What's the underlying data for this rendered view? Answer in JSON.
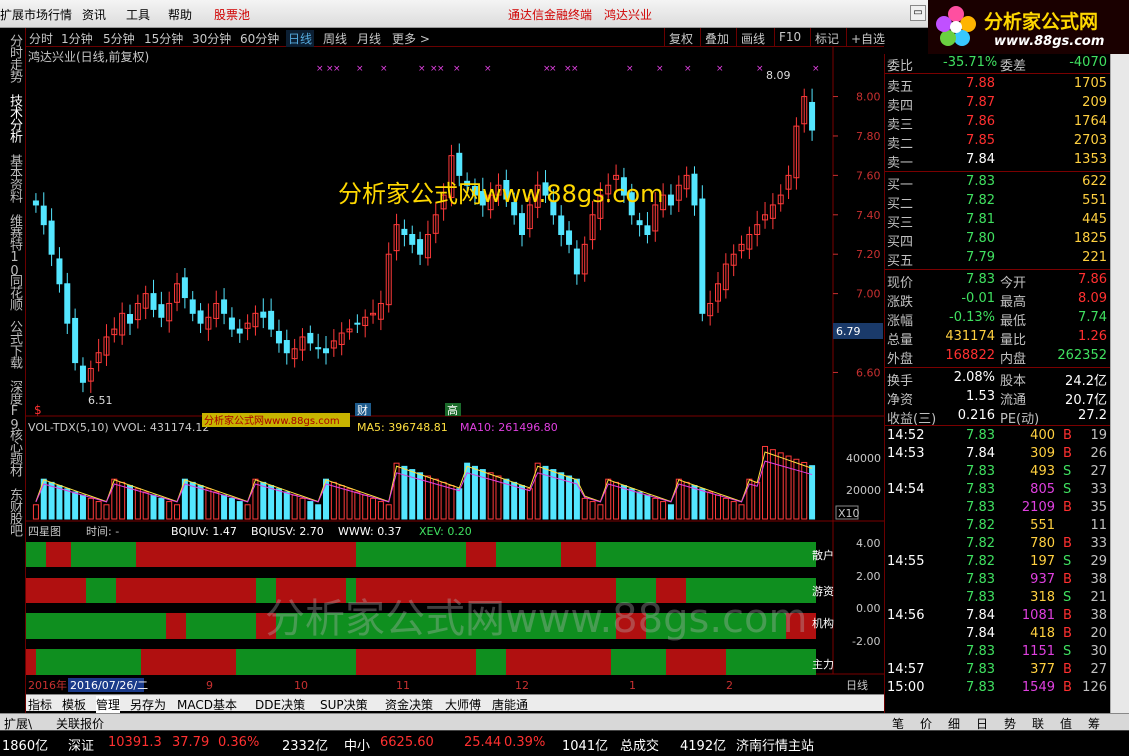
{
  "menu": {
    "items": [
      "扩展市场行情",
      "资讯",
      "工具",
      "帮助",
      "股票池",
      "通达信金融终端",
      "鸿达兴业"
    ]
  },
  "logo": {
    "title": "分析家公式网",
    "url": "www.88gs.com"
  },
  "left_tabs": [
    "分时走势",
    "技术分析",
    "基本资料",
    "维赛特10",
    "同花顺",
    "公式下载",
    "深度F9",
    "核心题材",
    "东财股吧"
  ],
  "period_tabs": [
    "分时",
    "1分钟",
    "5分钟",
    "15分钟",
    "30分钟",
    "60分钟",
    "日线",
    "周线",
    "月线",
    "更多 >"
  ],
  "toolbar_right": [
    "复权",
    "叠加",
    "画线",
    "F10",
    "标记",
    "+自选"
  ],
  "chart_title": "鸿达兴业(日线,前复权)",
  "watermark": "分析家公式网www.88gs.com",
  "watermark2": "分析家公式网www.88gs.com",
  "price_chart": {
    "ylim": [
      6.45,
      8.15
    ],
    "y_ticks": [
      "8.00",
      "7.80",
      "7.60",
      "7.40",
      "7.20",
      "7.00",
      "6.80",
      "6.60"
    ],
    "high_label": "8.09",
    "low_label": "6.51",
    "current_price_tag": "6.79",
    "markers": {
      "dollar": "$",
      "cai": "财",
      "gao": "高"
    }
  },
  "vol_panel": {
    "label": "VOL-TDX(5,10)",
    "vvol": "VVOL: 431174.12",
    "ma5": "MA5: 396748.81",
    "ma10": "MA10: 261496.80",
    "overlay": "分析家公式网www.88gs.com",
    "y_ticks": [
      "40000",
      "20000"
    ],
    "scale": "X10"
  },
  "sub_panel": {
    "label": "四星图",
    "time": "时间: -",
    "bqiuv": "BQIUV: 1.47",
    "bqiusv": "BQIUSV: 2.70",
    "www": "WWW: 0.37",
    "xev": "XEV: 0.20",
    "band_labels": [
      "散户",
      "游资",
      "机构",
      "主力"
    ],
    "y_ticks": [
      "4.00",
      "2.00",
      "0.00",
      "-2.00"
    ]
  },
  "date_axis": {
    "year": "2016年",
    "cursor_date": "2016/07/26/二",
    "months": [
      "9",
      "10",
      "11",
      "12",
      "1",
      "2"
    ],
    "period": "日线"
  },
  "bottom_tabs": [
    "指标",
    "模板",
    "管理",
    "另存为",
    "MACD基本",
    "DDE决策",
    "SUP决策",
    "资金决策",
    "大师傅",
    "唐能通"
  ],
  "bottom_tabs2": [
    "扩展\\",
    "关联报价"
  ],
  "quote": {
    "weibi_label": "委比",
    "weibi": "-35.71%",
    "weicha_label": "委差",
    "weicha": "-4070",
    "asks": [
      {
        "label": "卖五",
        "price": "7.88",
        "vol": "1705"
      },
      {
        "label": "卖四",
        "price": "7.87",
        "vol": "209"
      },
      {
        "label": "卖三",
        "price": "7.86",
        "vol": "1764"
      },
      {
        "label": "卖二",
        "price": "7.85",
        "vol": "2703"
      },
      {
        "label": "卖一",
        "price": "7.84",
        "vol": "1353"
      }
    ],
    "bids": [
      {
        "label": "买一",
        "price": "7.83",
        "vol": "622"
      },
      {
        "label": "买二",
        "price": "7.82",
        "vol": "551"
      },
      {
        "label": "买三",
        "price": "7.81",
        "vol": "445"
      },
      {
        "label": "买四",
        "price": "7.80",
        "vol": "1825"
      },
      {
        "label": "买五",
        "price": "7.79",
        "vol": "221"
      }
    ],
    "stats": [
      {
        "l1": "现价",
        "v1": "7.83",
        "l2": "今开",
        "v2": "7.86"
      },
      {
        "l1": "涨跌",
        "v1": "-0.01",
        "l2": "最高",
        "v2": "8.09"
      },
      {
        "l1": "涨幅",
        "v1": "-0.13%",
        "l2": "最低",
        "v2": "7.74"
      },
      {
        "l1": "总量",
        "v1": "431174",
        "l2": "量比",
        "v2": "1.26"
      },
      {
        "l1": "外盘",
        "v1": "168822",
        "l2": "内盘",
        "v2": "262352"
      }
    ],
    "stats2": [
      {
        "l1": "换手",
        "v1": "2.08%",
        "l2": "股本",
        "v2": "24.2亿"
      },
      {
        "l1": "净资",
        "v1": "1.53",
        "l2": "流通",
        "v2": "20.7亿"
      },
      {
        "l1": "收益(三)",
        "v1": "0.216",
        "l2": "PE(动)",
        "v2": "27.2"
      }
    ],
    "ticks": [
      {
        "t": "14:52",
        "p": "7.83",
        "v": "400",
        "bs": "B",
        "n": "19"
      },
      {
        "t": "14:53",
        "p": "7.84",
        "v": "309",
        "bs": "B",
        "n": "26"
      },
      {
        "t": "",
        "p": "7.83",
        "v": "493",
        "bs": "S",
        "n": "27"
      },
      {
        "t": "14:54",
        "p": "7.83",
        "v": "805",
        "bs": "S",
        "n": "33"
      },
      {
        "t": "",
        "p": "7.83",
        "v": "2109",
        "bs": "B",
        "n": "35"
      },
      {
        "t": "",
        "p": "7.82",
        "v": "551",
        "bs": "",
        "n": "11"
      },
      {
        "t": "",
        "p": "7.82",
        "v": "780",
        "bs": "B",
        "n": "33"
      },
      {
        "t": "14:55",
        "p": "7.82",
        "v": "197",
        "bs": "S",
        "n": "29"
      },
      {
        "t": "",
        "p": "7.83",
        "v": "937",
        "bs": "B",
        "n": "38"
      },
      {
        "t": "",
        "p": "7.83",
        "v": "318",
        "bs": "S",
        "n": "21"
      },
      {
        "t": "14:56",
        "p": "7.84",
        "v": "1081",
        "bs": "B",
        "n": "38"
      },
      {
        "t": "",
        "p": "7.84",
        "v": "418",
        "bs": "B",
        "n": "20"
      },
      {
        "t": "",
        "p": "7.83",
        "v": "1151",
        "bs": "S",
        "n": "30"
      },
      {
        "t": "14:57",
        "p": "7.83",
        "v": "377",
        "bs": "B",
        "n": "27"
      },
      {
        "t": "15:00",
        "p": "7.83",
        "v": "1549",
        "bs": "B",
        "n": "126"
      }
    ]
  },
  "rp_tabs": [
    "笔",
    "价",
    "细",
    "日",
    "势",
    "联",
    "值",
    "筹"
  ],
  "statusbar": {
    "items": [
      "1860亿",
      "深证",
      "10391.3",
      "37.79",
      "0.36%",
      "2332亿",
      "中小",
      "6625.60",
      "25.44",
      "0.39%",
      "1041亿",
      "总成交",
      "4192亿",
      "济南行情主站"
    ]
  },
  "chart_data": {
    "type": "candlestick",
    "title": "鸿达兴业(日线,前复权)",
    "x_months": [
      "9",
      "10",
      "11",
      "12",
      "1",
      "2"
    ],
    "ylim": [
      6.45,
      8.15
    ],
    "approx_close": [
      7.45,
      7.35,
      7.2,
      7.05,
      6.85,
      6.65,
      6.55,
      6.62,
      6.7,
      6.78,
      6.82,
      6.9,
      6.85,
      6.95,
      7.0,
      6.92,
      6.88,
      6.95,
      7.05,
      6.98,
      6.9,
      6.85,
      6.88,
      6.95,
      6.9,
      6.82,
      6.8,
      6.85,
      6.9,
      6.88,
      6.82,
      6.75,
      6.7,
      6.72,
      6.78,
      6.75,
      6.72,
      6.7,
      6.76,
      6.8,
      6.82,
      6.85,
      6.88,
      6.9,
      6.95,
      7.2,
      7.35,
      7.3,
      7.25,
      7.2,
      7.3,
      7.4,
      7.5,
      7.7,
      7.6,
      7.55,
      7.5,
      7.45,
      7.5,
      7.55,
      7.48,
      7.4,
      7.3,
      7.45,
      7.55,
      7.5,
      7.4,
      7.3,
      7.25,
      7.1,
      7.25,
      7.4,
      7.5,
      7.55,
      7.6,
      7.5,
      7.4,
      7.35,
      7.3,
      7.45,
      7.5,
      7.45,
      7.55,
      7.6,
      7.45,
      6.9,
      6.95,
      7.05,
      7.15,
      7.2,
      7.25,
      7.3,
      7.35,
      7.4,
      7.45,
      7.5,
      7.6,
      7.85,
      8.0,
      7.83
    ],
    "volume_max": 45000,
    "volume_ma_series": [
      "MA5",
      "MA10"
    ]
  }
}
